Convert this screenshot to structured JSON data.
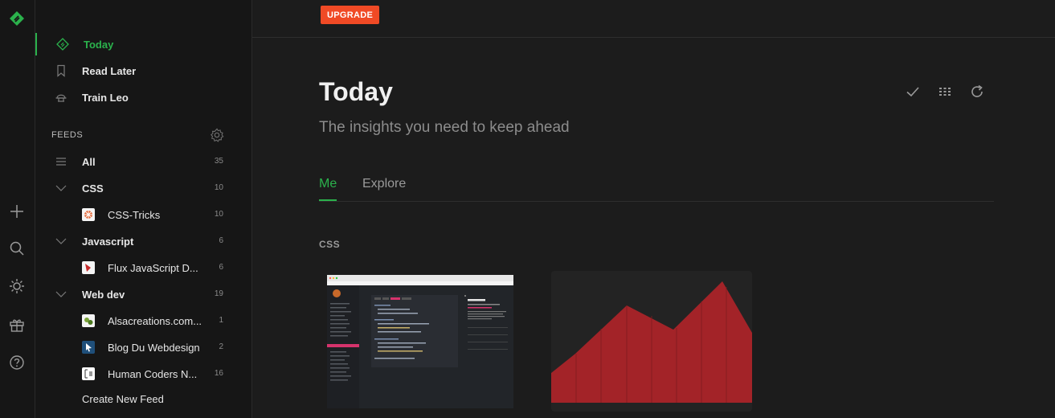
{
  "colors": {
    "accent": "#2bb24c",
    "upgrade": "#f04a25",
    "chart_fill": "#a32328"
  },
  "rail": {
    "icons": [
      "feedly-logo-icon",
      "plus-icon",
      "search-icon",
      "theme-sun-icon",
      "gift-icon",
      "help-icon"
    ]
  },
  "sidebar": {
    "nav": [
      {
        "label": "Today",
        "icon": "today-icon"
      },
      {
        "label": "Read Later",
        "icon": "bookmark-icon"
      },
      {
        "label": "Train Leo",
        "icon": "leo-icon"
      }
    ],
    "feeds_header": "FEEDS",
    "feeds": [
      {
        "label": "All",
        "count": "35",
        "icon": "list-icon"
      },
      {
        "label": "CSS",
        "count": "10",
        "icon": "chevron-down-icon"
      },
      {
        "label": "CSS-Tricks",
        "count": "10",
        "favicon": "css-tricks-favicon"
      },
      {
        "label": "Javascript",
        "count": "6",
        "icon": "chevron-down-icon"
      },
      {
        "label": "Flux JavaScript D...",
        "count": "6",
        "favicon": "flux-favicon"
      },
      {
        "label": "Web dev",
        "count": "19",
        "icon": "chevron-down-icon"
      },
      {
        "label": "Alsacreations.com...",
        "count": "1",
        "favicon": "alsacreations-favicon"
      },
      {
        "label": "Blog Du Webdesign",
        "count": "2",
        "favicon": "blog-du-webdesign-favicon"
      },
      {
        "label": "Human Coders N...",
        "count": "16",
        "favicon": "human-coders-favicon"
      }
    ],
    "create_feed": "Create New Feed"
  },
  "main": {
    "upgrade": "UPGRADE",
    "title": "Today",
    "subtitle": "The insights you need to keep ahead",
    "tabs": [
      "Me",
      "Explore"
    ],
    "section": "CSS",
    "toolbar_icons": [
      "mark-read-check-icon",
      "layout-grid-icon",
      "refresh-icon"
    ]
  }
}
